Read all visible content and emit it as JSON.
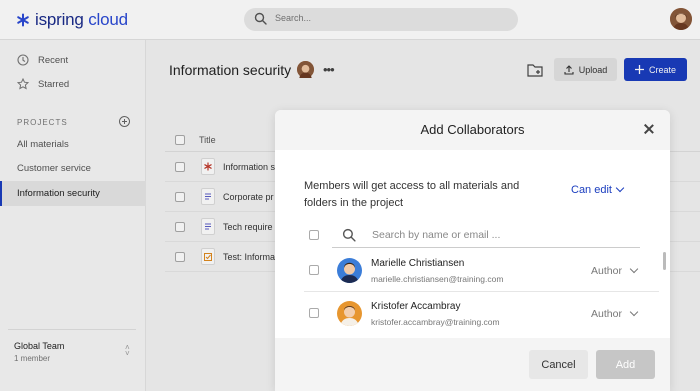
{
  "header": {
    "logo_text_a": "ispring",
    "logo_text_b": "cloud",
    "search_placeholder": "Search..."
  },
  "sidebar": {
    "nav": [
      {
        "label": "Recent",
        "icon": "clock-icon"
      },
      {
        "label": "Starred",
        "icon": "star-icon"
      }
    ],
    "projects_label": "PROJECTS",
    "projects": [
      {
        "label": "All materials"
      },
      {
        "label": "Customer service"
      },
      {
        "label": "Information security",
        "active": true
      }
    ],
    "team_name": "Global Team",
    "team_count": "1 member"
  },
  "main": {
    "title": "Information security",
    "upload_label": "Upload",
    "create_label": "Create",
    "table_header": "Title",
    "rows": [
      {
        "name": "Information s",
        "icon": "quiz-icon"
      },
      {
        "name": "Corporate pr",
        "icon": "document-icon"
      },
      {
        "name": "Tech require",
        "icon": "document-icon"
      },
      {
        "name": "Test: Informa",
        "icon": "test-icon"
      }
    ]
  },
  "modal": {
    "title": "Add Collaborators",
    "description": "Members will get access to all materials and folders in the project",
    "permission": "Can edit",
    "search_placeholder": "Search by name or email ...",
    "members": [
      {
        "name": "Marielle Christiansen",
        "email": "marielle.christiansen@training.com",
        "role": "Author"
      },
      {
        "name": "Kristofer Accambray",
        "email": "kristofer.accambray@training.com",
        "role": "Author"
      }
    ],
    "cancel_label": "Cancel",
    "add_label": "Add"
  },
  "colors": {
    "accent": "#1a3dbf",
    "logo": "#1c2d8c"
  }
}
